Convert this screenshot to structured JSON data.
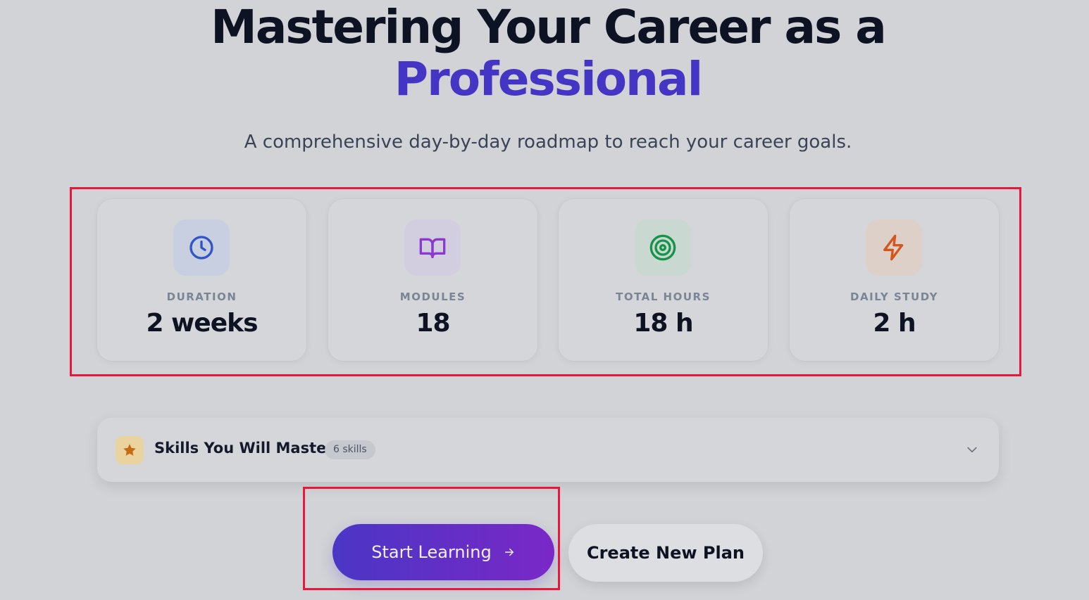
{
  "hero": {
    "title_line1": "Mastering Your Career as a",
    "title_line2": "Professional",
    "subtitle": "A comprehensive day-by-day roadmap to reach your career goals."
  },
  "stats": [
    {
      "label": "DURATION",
      "value": "2 weeks",
      "icon": "clock-icon",
      "color": "#2f55c8",
      "bg": "#c8cfe0"
    },
    {
      "label": "MODULES",
      "value": "18",
      "icon": "book-open-icon",
      "color": "#8a3ad0",
      "bg": "#d3cde0"
    },
    {
      "label": "TOTAL HOURS",
      "value": "18 h",
      "icon": "target-icon",
      "color": "#159447",
      "bg": "#c9d8d0"
    },
    {
      "label": "DAILY STUDY",
      "value": "2 h",
      "icon": "lightning-icon",
      "color": "#d4561a",
      "bg": "#ddd0c9"
    }
  ],
  "skills": {
    "title": "Skills You Will Master",
    "badge": "6 skills",
    "icon": "star-icon",
    "chevron": "chevron-down-icon"
  },
  "actions": {
    "start_label": "Start Learning",
    "start_icon": "arrow-right-icon",
    "new_plan_label": "Create New Plan"
  },
  "colors": {
    "accent": "#4535c4",
    "highlight": "#e8173b",
    "background": "#d2d3d6"
  }
}
